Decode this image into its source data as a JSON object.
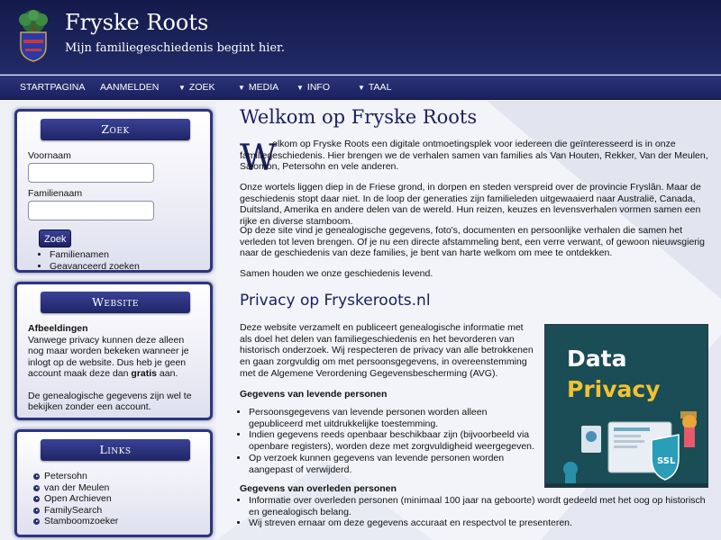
{
  "header": {
    "title": "Fryske Roots",
    "subtitle": "Mijn familiegeschiedenis begint hier."
  },
  "nav": {
    "items": [
      {
        "label": "STARTPAGINA",
        "has_dropdown": false
      },
      {
        "label": "AANMELDEN",
        "has_dropdown": false
      },
      {
        "label": "ZOEK",
        "has_dropdown": true
      },
      {
        "label": "MEDIA",
        "has_dropdown": true
      },
      {
        "label": "INFO",
        "has_dropdown": true
      },
      {
        "label": "TAAL",
        "has_dropdown": true
      }
    ]
  },
  "sidebar": {
    "search": {
      "title": "Zoek",
      "first_name_label": "Voornaam",
      "first_name_value": "",
      "last_name_label": "Familienaam",
      "last_name_value": "",
      "button": "Zoek",
      "links": [
        "Familienamen",
        "Geavanceerd zoeken"
      ]
    },
    "website": {
      "title": "Website",
      "heading": "Afbeeldingen",
      "text1": "Vanwege privacy kunnen deze alleen nog maar worden bekeken wanneer je inlogt op de website. Dus heb je geen account maak deze dan ",
      "text1_bold": "gratis",
      "text1_end": " aan.",
      "text2": "De genealogische gegevens zijn wel te bekijken zonder een account."
    },
    "links": {
      "title": "Links",
      "items": [
        "Petersohn",
        "van der Meulen",
        "Open Archieven",
        "FamilySearch",
        "Stamboomzoeker"
      ]
    }
  },
  "main": {
    "title": "Welkom op Fryske Roots",
    "dropcap": "W",
    "intro": "elkom op Fryske Roots een digitale ontmoetingsplek voor iedereen die geïnteresseerd is in onze familiegeschiedenis. Hier brengen we de verhalen samen van families als Van Houten, Rekker, Van der Meulen, Salomon, Petersohn en vele anderen.",
    "p2": "Onze wortels liggen diep in de Friese grond, in dorpen en steden verspreid over de provincie Fryslân. Maar de geschiedenis stopt daar niet. In de loop der generaties zijn familieleden uitgewaaierd naar Australië, Canada, Duitsland, Amerika en andere delen van de wereld. Hun reizen, keuzes en levensverhalen vormen samen een rijke en diverse stamboom.",
    "p3": "Op deze site vind je genealogische gegevens, foto's, documenten en persoonlijke verhalen die samen het verleden tot leven brengen. Of je nu een directe afstammeling bent, een verre verwant, of gewoon nieuwsgierig naar de geschiedenis van deze families, je bent van harte welkom om mee te ontdekken.",
    "p4": "Samen houden we onze geschiedenis levend.",
    "privacy_title": "Privacy op Fryskeroots.nl",
    "privacy_p1": "Deze website verzamelt en publiceert genealogische informatie met als doel het delen van familiegeschiedenis en het bevorderen van historisch onderzoek. Wij respecteren de privacy van alle betrokkenen en gaan zorgvuldig om met persoonsgegevens, in overeenstemming met de Algemene Verordening Gegevensbescherming (AVG).",
    "living_heading": "Gegevens van levende personen",
    "living_items": [
      "Persoonsgegevens van levende personen worden alleen gepubliceerd met uitdrukkelijke toestemming.",
      "Indien gegevens reeds openbaar beschikbaar zijn (bijvoorbeeld via openbare registers), worden deze met zorgvuldigheid weergegeven.",
      "Op verzoek kunnen gegevens van levende personen worden aangepast of verwijderd."
    ],
    "deceased_heading": "Gegevens van overleden personen",
    "deceased_items": [
      "Informatie over overleden personen (minimaal 100 jaar na geboorte) wordt gedeeld met het oog op historisch en genealogisch belang.",
      "Wij streven ernaar om deze gegevens accuraat en respectvol te presenteren."
    ],
    "image": {
      "line1": "Data",
      "line2": "Privacy",
      "badge": "SSL"
    }
  },
  "colors": {
    "navy": "#1b2160",
    "accent_yellow": "#f2c230",
    "image_bg": "#1a4d56"
  }
}
